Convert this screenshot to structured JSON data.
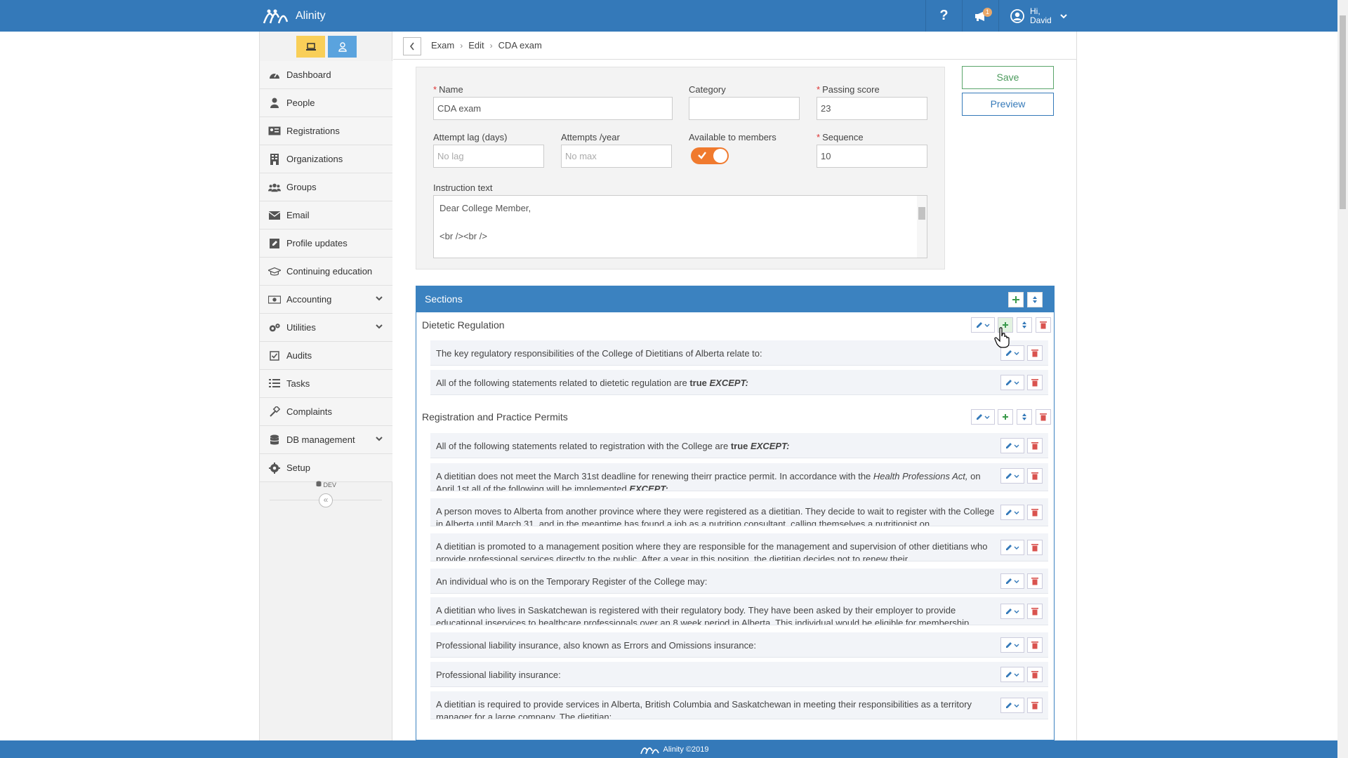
{
  "app": {
    "brand": "Alinity",
    "footer": "Alinity ©2019"
  },
  "header": {
    "help": "?",
    "notification_count": "1",
    "greeting_line1": "Hi,",
    "greeting_line2": "David"
  },
  "nav": {
    "items": [
      {
        "label": "Dashboard",
        "icon": "dashboard-icon"
      },
      {
        "label": "People",
        "icon": "person-icon"
      },
      {
        "label": "Registrations",
        "icon": "id-card-icon"
      },
      {
        "label": "Organizations",
        "icon": "building-icon"
      },
      {
        "label": "Groups",
        "icon": "users-icon"
      },
      {
        "label": "Email",
        "icon": "envelope-icon"
      },
      {
        "label": "Profile updates",
        "icon": "edit-icon"
      },
      {
        "label": "Continuing education",
        "icon": "graduation-cap-icon"
      },
      {
        "label": "Accounting",
        "icon": "money-icon"
      },
      {
        "label": "Utilities",
        "icon": "gears-icon"
      },
      {
        "label": "Audits",
        "icon": "check-square-icon"
      },
      {
        "label": "Tasks",
        "icon": "list-icon"
      },
      {
        "label": "Complaints",
        "icon": "gavel-icon"
      },
      {
        "label": "DB management",
        "icon": "database-icon"
      },
      {
        "label": "Setup",
        "icon": "gear-icon"
      }
    ],
    "dev_label": "DEV",
    "collapse": "«"
  },
  "breadcrumb": {
    "items": [
      "Exam",
      "Edit",
      "CDA exam"
    ]
  },
  "form": {
    "name_label": "Name",
    "name_value": "CDA exam",
    "category_label": "Category",
    "category_value": "",
    "passing_label": "Passing score",
    "passing_value": "23",
    "lag_label": "Attempt lag (days)",
    "lag_placeholder": "No lag",
    "attempts_label": "Attempts /year",
    "attempts_placeholder": "No max",
    "available_label": "Available to members",
    "available_on": true,
    "sequence_label": "Sequence",
    "sequence_value": "10",
    "instruction_label": "Instruction text",
    "instruction_line1": "Dear College Member,",
    "instruction_line2": "<br /><br />"
  },
  "actions": {
    "save": "Save",
    "preview": "Preview"
  },
  "sections": {
    "title": "Sections",
    "groups": [
      {
        "title": "Dietetic Regulation",
        "questions": [
          {
            "pre": "The key regulatory responsibilities of the College of Dietitians of Alberta relate to:",
            "bold": "",
            "em": ""
          },
          {
            "pre": "All of the following statements related to dietetic regulation are ",
            "bold": "true",
            "em": "EXCEPT:"
          }
        ]
      },
      {
        "title": "Registration and Practice Permits",
        "questions": [
          {
            "pre": "All of the following statements related to registration with the College are ",
            "bold": "true",
            "em": "EXCEPT:"
          },
          {
            "pre": "A dietitian does not meet the March 31st deadline for renewing theirr practice permit. In accordance with the ",
            "em1": "Health Professions Act,",
            "post": " on April 1st all of the following will be implemented ",
            "em2": "EXCEPT:"
          },
          {
            "pre": "A person moves to Alberta from another province where they were registered as a dietitian. They decide to wait to register with the College in Alberta until March 31, and in the meantime has found a job as a nutrition consultant, calling themselves a nutritionist on"
          },
          {
            "pre": "A dietitian is promoted to a management position where they are responsible for the management and supervision of other dietitians who provide professional services directly to the public. After a year in this position, the dietitian decides not to renew their"
          },
          {
            "pre": "An individual who is on the Temporary Register of the College may:"
          },
          {
            "pre": "A dietitian who lives in Saskatchewan is registered with their regulatory body. They have been asked by their employer to provide educational inservices to healthcare professionals over an 8 week period in Alberta. This individual would be eligible for membership"
          },
          {
            "pre": "Professional liability insurance, also known as Errors and Omissions insurance:"
          },
          {
            "pre": "Professional liability insurance:"
          },
          {
            "pre": "A dietitian is required to provide services in Alberta, British Columbia and Saskatchewan in meeting their responsibilities as a territory manager for a large company. The dietitian:"
          }
        ]
      }
    ]
  },
  "colors": {
    "primary": "#3479b9",
    "accent": "#f07a2e",
    "save": "#4b9a5c",
    "danger": "#d9534f"
  }
}
